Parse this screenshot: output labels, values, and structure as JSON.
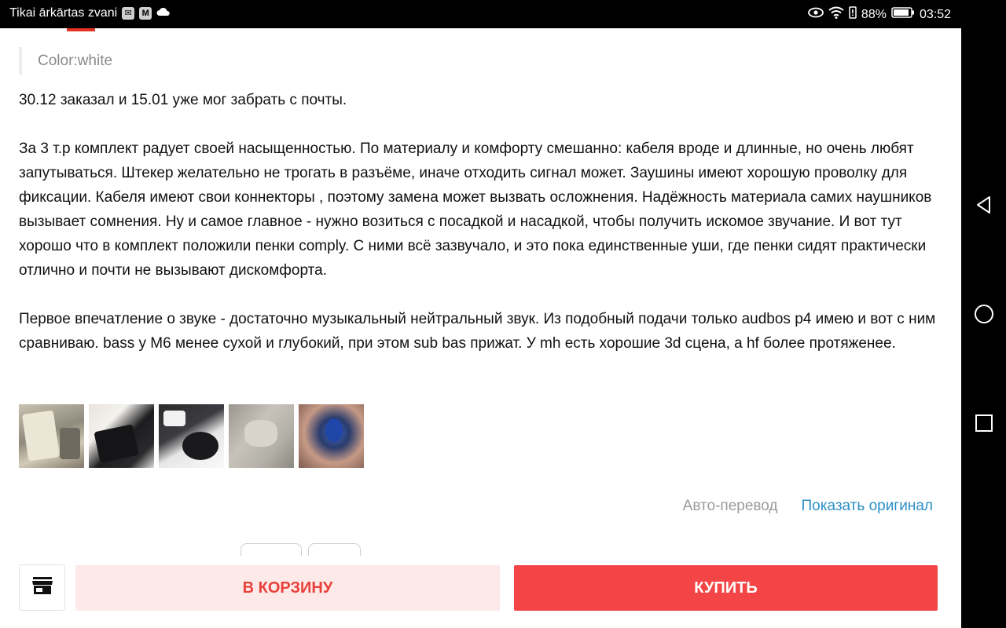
{
  "status_bar": {
    "carrier": "Tikai ārkārtas zvani",
    "badge_m": "M",
    "battery": "88%",
    "time": "03:52"
  },
  "review": {
    "color_label": "Color:white",
    "paragraphs": [
      "30.12 заказал и 15.01 уже мог забрать с почты.",
      "За 3 т.р комплект радует своей насыщенностью. По материалу и комфорту смешанно: кабеля вроде и длинные, но очень любят запутываться. Штекер желательно не трогать в разъёме, иначе отходить сигнал может. Заушины имеют хорошую проволку для фиксации. Кабеля имеют свои коннекторы , поэтому замена может вызвать осложнения. Надёжность материала самих наушников вызывает сомнения. Ну и самое главное - нужно возиться с посадкой и насадкой, чтобы получить искомое звучание. И вот тут хорошо что в комплект положили пенки comply. С ними всё зазвучало, и это пока единственные уши, где пенки сидят практически отлично и почти не вызывают дискомфорта.",
      "Первое впечатление о звуке - достаточно музыкальный нейтральный звук. Из подобный подачи только audbos p4 имею и вот с ним сравниваю. bass у M6 менее сухой и глубокий, при этом sub bas прижат. У mh есть хорошие 3d сцена, а hf более протяженее."
    ],
    "photo_count": 5
  },
  "translation": {
    "auto_label": "Авто-перевод",
    "show_original": "Показать оригинал"
  },
  "actions": {
    "store_icon": "store-icon",
    "cart_label": "В КОРЗИНУ",
    "buy_label": "КУПИТЬ"
  },
  "colors": {
    "accent_red": "#f34545",
    "cart_bg": "#fde9e8",
    "link_blue": "#2b8fc7"
  }
}
